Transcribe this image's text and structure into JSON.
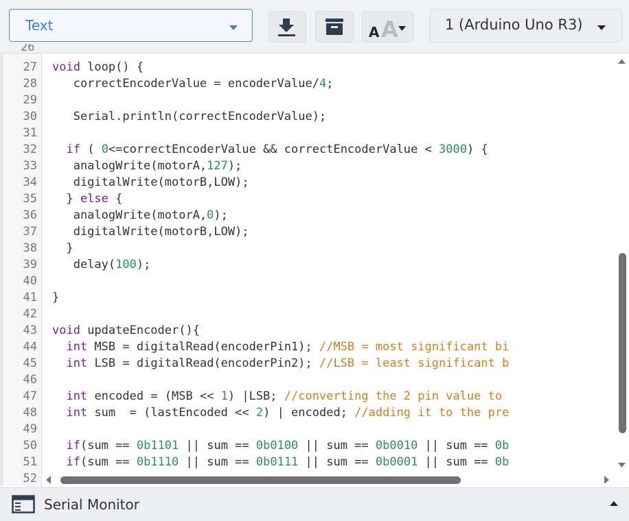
{
  "toolbar": {
    "editor_mode": "Text",
    "device": "1 (Arduino Uno R3)"
  },
  "code_lines": [
    {
      "num": "27",
      "tokens": [
        {
          "t": "void",
          "c": "k"
        },
        {
          "t": " loop() {"
        }
      ]
    },
    {
      "num": "28",
      "tokens": [
        {
          "t": "   correctEncoderValue = encoderValue/"
        },
        {
          "t": "4",
          "c": "n"
        },
        {
          "t": ";"
        }
      ]
    },
    {
      "num": "29",
      "tokens": []
    },
    {
      "num": "30",
      "tokens": [
        {
          "t": "   Serial.println(correctEncoderValue);"
        }
      ]
    },
    {
      "num": "31",
      "tokens": []
    },
    {
      "num": "32",
      "tokens": [
        {
          "t": "  "
        },
        {
          "t": "if",
          "c": "k"
        },
        {
          "t": " ( "
        },
        {
          "t": "0",
          "c": "n"
        },
        {
          "t": "<=correctEncoderValue && correctEncoderValue < "
        },
        {
          "t": "3000",
          "c": "n"
        },
        {
          "t": ") {"
        }
      ]
    },
    {
      "num": "33",
      "tokens": [
        {
          "t": "   analogWrite(motorA,"
        },
        {
          "t": "127",
          "c": "n"
        },
        {
          "t": ");"
        }
      ]
    },
    {
      "num": "34",
      "tokens": [
        {
          "t": "   digitalWrite(motorB,LOW);"
        }
      ]
    },
    {
      "num": "35",
      "tokens": [
        {
          "t": "  } "
        },
        {
          "t": "else",
          "c": "k"
        },
        {
          "t": " {"
        }
      ]
    },
    {
      "num": "36",
      "tokens": [
        {
          "t": "   analogWrite(motorA,"
        },
        {
          "t": "0",
          "c": "n"
        },
        {
          "t": ");"
        }
      ]
    },
    {
      "num": "37",
      "tokens": [
        {
          "t": "   digitalWrite(motorB,LOW);"
        }
      ]
    },
    {
      "num": "38",
      "tokens": [
        {
          "t": "  }"
        }
      ]
    },
    {
      "num": "39",
      "tokens": [
        {
          "t": "   delay("
        },
        {
          "t": "100",
          "c": "n"
        },
        {
          "t": ");"
        }
      ]
    },
    {
      "num": "40",
      "tokens": []
    },
    {
      "num": "41",
      "tokens": [
        {
          "t": "}"
        }
      ]
    },
    {
      "num": "42",
      "tokens": []
    },
    {
      "num": "43",
      "tokens": [
        {
          "t": "void",
          "c": "k"
        },
        {
          "t": " updateEncoder(){"
        }
      ]
    },
    {
      "num": "44",
      "tokens": [
        {
          "t": "  "
        },
        {
          "t": "int",
          "c": "k"
        },
        {
          "t": " MSB = digitalRead(encoderPin1); "
        },
        {
          "t": "//MSB = most significant bi",
          "c": "c"
        }
      ]
    },
    {
      "num": "45",
      "tokens": [
        {
          "t": "  "
        },
        {
          "t": "int",
          "c": "k"
        },
        {
          "t": " LSB = digitalRead(encoderPin2); "
        },
        {
          "t": "//LSB = least significant b",
          "c": "c"
        }
      ]
    },
    {
      "num": "46",
      "tokens": []
    },
    {
      "num": "47",
      "tokens": [
        {
          "t": "  "
        },
        {
          "t": "int",
          "c": "k"
        },
        {
          "t": " encoded = (MSB << "
        },
        {
          "t": "1",
          "c": "n"
        },
        {
          "t": ") |LSB; "
        },
        {
          "t": "//converting the 2 pin value to",
          "c": "c"
        }
      ]
    },
    {
      "num": "48",
      "tokens": [
        {
          "t": "  "
        },
        {
          "t": "int",
          "c": "k"
        },
        {
          "t": " sum  = (lastEncoded << "
        },
        {
          "t": "2",
          "c": "n"
        },
        {
          "t": ") | encoded; "
        },
        {
          "t": "//adding it to the pre",
          "c": "c"
        }
      ]
    },
    {
      "num": "49",
      "tokens": []
    },
    {
      "num": "50",
      "tokens": [
        {
          "t": "  "
        },
        {
          "t": "if",
          "c": "k"
        },
        {
          "t": "(sum == "
        },
        {
          "t": "0b1101",
          "c": "n"
        },
        {
          "t": " || sum == "
        },
        {
          "t": "0b0100",
          "c": "n"
        },
        {
          "t": " || sum == "
        },
        {
          "t": "0b0010",
          "c": "n"
        },
        {
          "t": " || sum == "
        },
        {
          "t": "0b",
          "c": "n"
        }
      ]
    },
    {
      "num": "51",
      "tokens": [
        {
          "t": "  "
        },
        {
          "t": "if",
          "c": "k"
        },
        {
          "t": "(sum == "
        },
        {
          "t": "0b1110",
          "c": "n"
        },
        {
          "t": " || sum == "
        },
        {
          "t": "0b0111",
          "c": "n"
        },
        {
          "t": " || sum == "
        },
        {
          "t": "0b0001",
          "c": "n"
        },
        {
          "t": " || sum == "
        },
        {
          "t": "0b",
          "c": "n"
        }
      ]
    },
    {
      "num": "52",
      "tokens": []
    }
  ],
  "bottom": {
    "label": "Serial Monitor"
  }
}
